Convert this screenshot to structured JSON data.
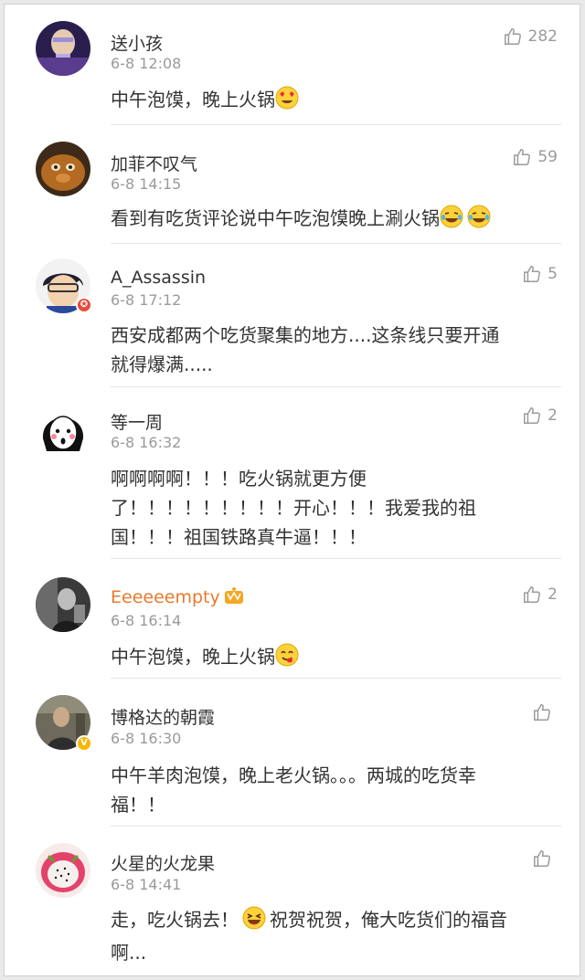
{
  "comments": [
    {
      "name": "送小孩",
      "time": "6-8 12:08",
      "likes": "282",
      "text": "中午泡馍，晚上火锅",
      "emoji": "heart-eyes-emoji"
    },
    {
      "name": "加菲不叹气",
      "time": "6-8 14:15",
      "likes": "59",
      "text": "看到有吃货评论说中午吃泡馍晚上涮火锅",
      "emoji": "tears-of-joy-emoji"
    },
    {
      "name": "A_Assassin",
      "time": "6-8 17:12",
      "likes": "5",
      "text": "西安成都两个吃货聚集的地方....这条线只要开通",
      "text2": "就得爆满....."
    },
    {
      "name": "等一周",
      "time": "6-8 16:32",
      "likes": "2",
      "text": "啊啊啊啊！！！吃火锅就更方便",
      "text2": "了！！！！！！！！！开心！！！我爱我的祖",
      "text3": "国！！！祖国铁路真牛逼！！！"
    },
    {
      "name": "Eeeeeempty",
      "time": "6-8 16:14",
      "likes": "2",
      "text": "中午泡馍，晚上火锅",
      "emoji": "yum-emoji"
    },
    {
      "name": "博格达的朝霞",
      "time": "6-8 16:30",
      "likes": "",
      "text": "中午羊肉泡馍，晚上老火锅。。。两城的吃货幸",
      "text2": "福！！"
    },
    {
      "name": "火星的火龙果",
      "time": "6-8 14:41",
      "likes": "",
      "text": "走，吃火锅去！",
      "text_after": "祝贺祝贺，俺大吃货们的福音",
      "text2": "啊..."
    }
  ],
  "colors": {
    "name": "#333333",
    "vip_name": "#e8792e",
    "meta": "#9a9a9a",
    "divider": "#e5e5e5"
  }
}
